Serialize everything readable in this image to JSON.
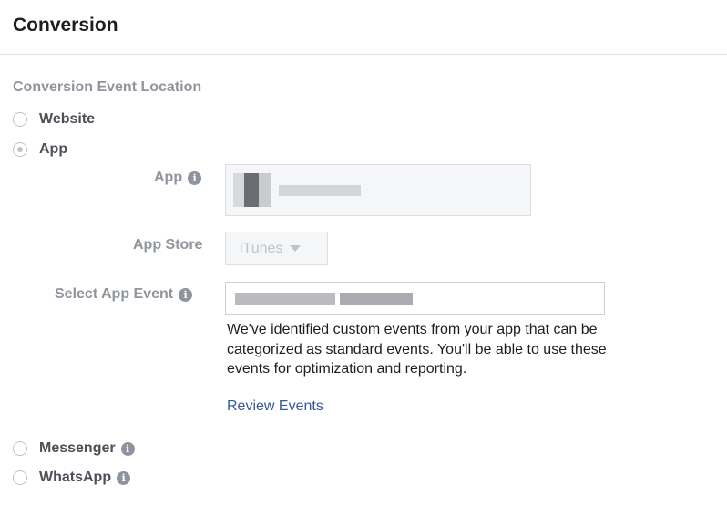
{
  "header": {
    "title": "Conversion"
  },
  "section": {
    "label": "Conversion Event Location"
  },
  "options": {
    "website": {
      "label": "Website",
      "selected": false
    },
    "app": {
      "label": "App",
      "selected": true
    },
    "messenger": {
      "label": "Messenger",
      "selected": false
    },
    "whatsapp": {
      "label": "WhatsApp",
      "selected": false
    }
  },
  "app_fields": {
    "app": {
      "label": "App",
      "value": ""
    },
    "app_store": {
      "label": "App Store",
      "value": "iTunes"
    },
    "select_app_event": {
      "label": "Select App Event",
      "value": "",
      "help_text": "We've identified custom events from your app that can be categorized as standard events. You'll be able to use these events for optimization and reporting.",
      "link_text": "Review Events"
    }
  },
  "icons": {
    "info": "i"
  },
  "colors": {
    "link": "#365899",
    "muted_label": "#90949c"
  }
}
